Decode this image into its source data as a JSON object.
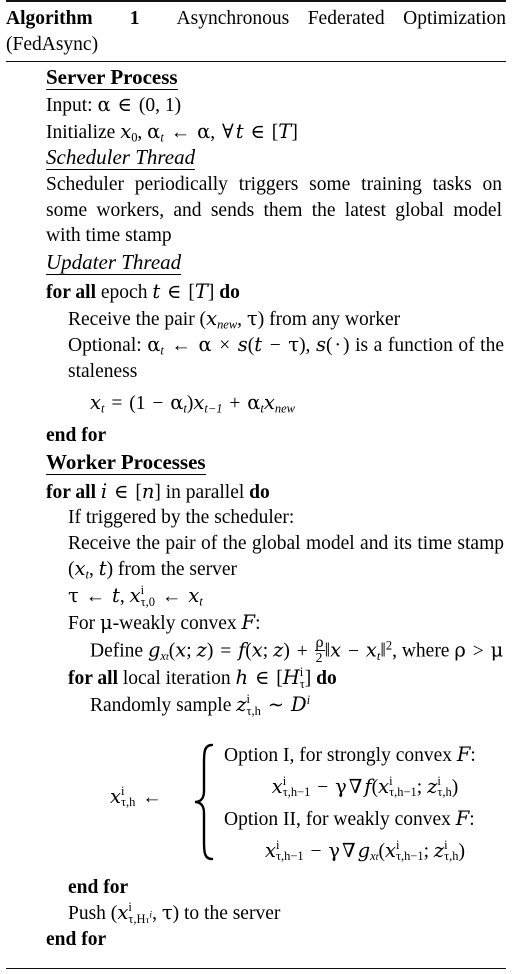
{
  "algorithm": {
    "label": "Algorithm",
    "number": "1",
    "title": "Asynchronous Federated Optimization",
    "title_cont": "(FedAsync)",
    "full_title": "Algorithm 1 Asynchronous Federated Optimization (FedAsync)"
  },
  "sections": {
    "server_process": "Server Process",
    "scheduler_thread": "Scheduler Thread",
    "updater_thread": "Updater Thread",
    "worker_processes": "Worker Processes"
  },
  "server": {
    "input_label": "Input:",
    "input_math": "α ∈ (0, 1)",
    "initialize_label": "Initialize",
    "initialize_math": "x₀, αt ← α, ∀t ∈ [T]"
  },
  "scheduler": {
    "text": "Scheduler periodically triggers some training tasks on some workers, and sends them the latest global model with time stamp"
  },
  "updater": {
    "for_all": "for all",
    "for_all_body": "epoch t ∈ [T]",
    "do": "do",
    "receive": "Receive the pair (xnew, τ) from any worker",
    "optional": "Optional: αt ← α × s(t − τ), s(·) is a function of the staleness",
    "update_eq": "xt = (1 − αt)xt−1 + αt xnew",
    "end_for": "end for"
  },
  "worker": {
    "for_all": "for all",
    "for_all_body": "i ∈ [n] in parallel",
    "do": "do",
    "if_triggered": "If triggered by the scheduler:",
    "receive": "Receive the pair of the global model and its time stamp (xt, t) from the server",
    "tau_assign": "τ ← t, x^i_{τ,0} ← xt",
    "for_mu": "For μ-weakly convex F:",
    "define": "Define g_{xt}(x; z) = f(x; z) + (ρ/2)‖x − xt‖², where ρ > μ",
    "inner_for_all": "for all",
    "inner_for_all_body": "local iteration h ∈ [H^i_τ]",
    "inner_do": "do",
    "randomly_sample": "Randomly sample z^i_{τ,h} ∼ D^i",
    "cases": {
      "lhs": "x^i_{τ,h} ←",
      "option1_label": "Option I, for strongly convex F:",
      "option1_expr": "x^i_{τ,h−1} − γ∇f(x^i_{τ,h−1}; z^i_{τ,h})",
      "option2_label": "Option II, for weakly convex F:",
      "option2_expr": "x^i_{τ,h−1} − γ∇g_{xt}(x^i_{τ,h−1}; z^i_{τ,h})"
    },
    "inner_end_for": "end for",
    "push": "Push (x^i_{τ,H^i_τ}, τ) to the server",
    "end_for": "end for"
  },
  "colors": {
    "text": "#000000",
    "rule": "#111111",
    "background": "#ffffff"
  }
}
